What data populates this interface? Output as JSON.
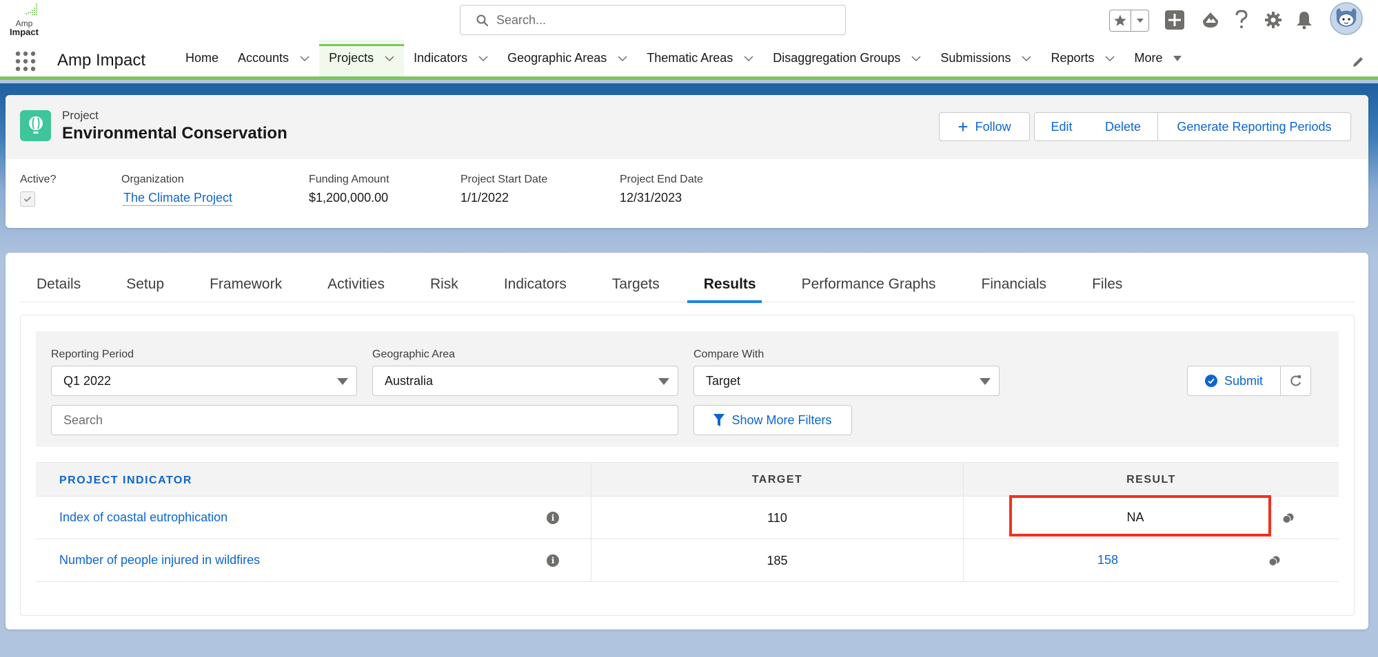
{
  "global_header": {
    "logo_top": "Amp",
    "logo_bottom": "Impact",
    "search_placeholder": "Search...",
    "utility_icons": [
      "favorites-star-icon",
      "favorites-dropdown-icon",
      "global-add-icon",
      "trailhead-icon",
      "help-icon",
      "setup-gear-icon",
      "notifications-bell-icon",
      "user-avatar"
    ]
  },
  "app_nav": {
    "app_name": "Amp Impact",
    "items": [
      {
        "label": "Home",
        "has_menu": false,
        "active": false
      },
      {
        "label": "Accounts",
        "has_menu": true,
        "active": false
      },
      {
        "label": "Projects",
        "has_menu": true,
        "active": true
      },
      {
        "label": "Indicators",
        "has_menu": true,
        "active": false
      },
      {
        "label": "Geographic Areas",
        "has_menu": true,
        "active": false
      },
      {
        "label": "Thematic Areas",
        "has_menu": true,
        "active": false
      },
      {
        "label": "Disaggregation Groups",
        "has_menu": true,
        "active": false
      },
      {
        "label": "Submissions",
        "has_menu": true,
        "active": false
      },
      {
        "label": "Reports",
        "has_menu": true,
        "active": false
      }
    ],
    "more_label": "More",
    "accent_color": "#7dc55a"
  },
  "record": {
    "type": "Project",
    "title": "Environmental Conservation",
    "actions": {
      "follow": "Follow",
      "edit": "Edit",
      "delete": "Delete",
      "generate": "Generate Reporting Periods"
    },
    "fields": {
      "active_label": "Active?",
      "active_value": true,
      "org_label": "Organization",
      "org_value": "The Climate Project",
      "funding_label": "Funding Amount",
      "funding_value": "$1,200,000.00",
      "start_label": "Project Start Date",
      "start_value": "1/1/2022",
      "end_label": "Project End Date",
      "end_value": "12/31/2023"
    }
  },
  "tabs": [
    {
      "label": "Details",
      "active": false
    },
    {
      "label": "Setup",
      "active": false
    },
    {
      "label": "Framework",
      "active": false
    },
    {
      "label": "Activities",
      "active": false
    },
    {
      "label": "Risk",
      "active": false
    },
    {
      "label": "Indicators",
      "active": false
    },
    {
      "label": "Targets",
      "active": false
    },
    {
      "label": "Results",
      "active": true
    },
    {
      "label": "Performance Graphs",
      "active": false
    },
    {
      "label": "Financials",
      "active": false
    },
    {
      "label": "Files",
      "active": false
    }
  ],
  "filters": {
    "reporting_period_label": "Reporting Period",
    "reporting_period_value": "Q1 2022",
    "geo_area_label": "Geographic Area",
    "geo_area_value": "Australia",
    "compare_label": "Compare With",
    "compare_value": "Target",
    "search_placeholder": "Search",
    "more_filters": "Show More Filters",
    "submit": "Submit"
  },
  "results_table": {
    "headers": {
      "indicator": "PROJECT INDICATOR",
      "target": "TARGET",
      "result": "RESULT"
    },
    "rows": [
      {
        "indicator": "Index of coastal eutrophication",
        "target": "110",
        "result": "NA",
        "highlighted": true
      },
      {
        "indicator": "Number of people injured in wildfires",
        "target": "185",
        "result": "158",
        "highlighted": false
      }
    ]
  },
  "colors": {
    "link_blue": "#0b66d0",
    "tab_active_underline": "#1b84e7",
    "record_icon": "#3fc59a",
    "highlight_red": "#f0321e"
  }
}
